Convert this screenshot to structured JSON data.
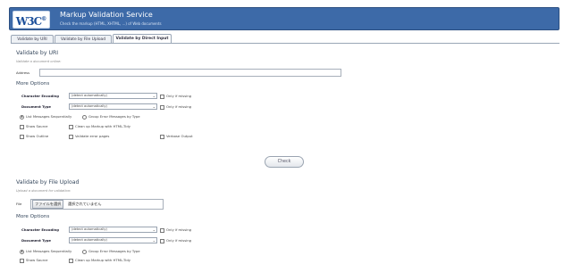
{
  "header": {
    "logo_text": "W3C",
    "logo_mark": "®",
    "title": "Markup Validation Service",
    "tagline": "Check the markup (HTML, XHTML, ...) of Web documents"
  },
  "tabs": [
    {
      "label": "Validate by URI"
    },
    {
      "label": "Validate by File Upload"
    },
    {
      "label": "Validate by Direct Input"
    }
  ],
  "uri_section": {
    "heading": "Validate by URI",
    "subtitle": "Validate a document online:",
    "address_label": "Address",
    "address_value": ""
  },
  "uri_options": {
    "heading": "More Options",
    "char_encoding_label": "Character Encoding",
    "char_encoding_value": "(detect automatically)",
    "only_if_missing_1": "Only if missing",
    "doctype_label": "Document Type",
    "doctype_value": "(detect automatically)",
    "only_if_missing_2": "Only if missing",
    "list_sequentially": "List Messages Sequentially",
    "group_by_type": "Group Error Messages by Type",
    "show_source": "Show Source",
    "clean_up": "Clean up Markup with HTML-Tidy",
    "show_outline": "Show Outline",
    "validate_error_pages": "Validate error pages",
    "verbose_output": "Verbose Output"
  },
  "check_button": "Check",
  "upload_section": {
    "heading": "Validate by File Upload",
    "subtitle": "Upload a document for validation:",
    "file_label": "File",
    "file_button": "ファイルを選択",
    "file_status": "選択されていません"
  },
  "upload_options": {
    "heading": "More Options",
    "char_encoding_label": "Character Encoding",
    "char_encoding_value": "(detect automatically)",
    "only_if_missing_1": "Only if missing",
    "doctype_label": "Document Type",
    "doctype_value": "(detect automatically)",
    "only_if_missing_2": "Only if missing",
    "list_sequentially": "List Messages Sequentially",
    "group_by_type": "Group Error Messages by Type",
    "show_source": "Show Source",
    "clean_up": "Clean up Markup with HTML-Tidy"
  },
  "colors": {
    "header_bg": "#3d6aa8",
    "accent": "#1a4e9a"
  }
}
